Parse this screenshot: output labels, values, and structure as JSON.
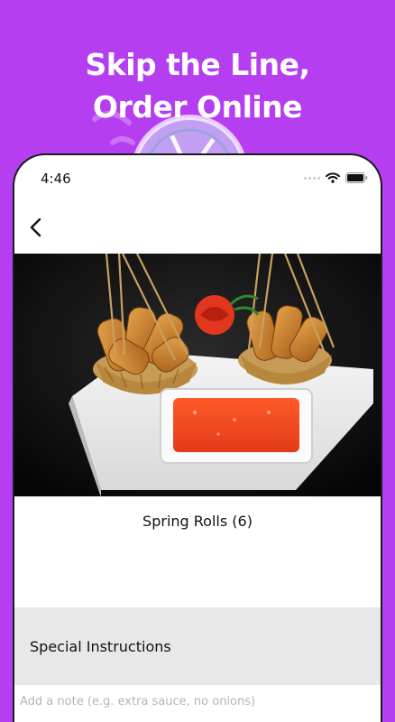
{
  "promo": {
    "headline_line1": "Skip the Line,",
    "headline_line2": "Order Online"
  },
  "status_bar": {
    "time": "4:46",
    "icons": [
      "signal-icon",
      "wifi-icon",
      "battery-icon"
    ]
  },
  "nav": {
    "back_icon": "chevron-left-icon"
  },
  "product": {
    "image": "spring-rolls-photo",
    "name": "Spring Rolls (6)"
  },
  "special_instructions": {
    "title": "Special Instructions",
    "placeholder": "Add a note (e.g. extra sauce, no onions)",
    "value": ""
  },
  "colors": {
    "brand_purple": "#b43ef0",
    "section_gray": "#e8e8e8"
  }
}
